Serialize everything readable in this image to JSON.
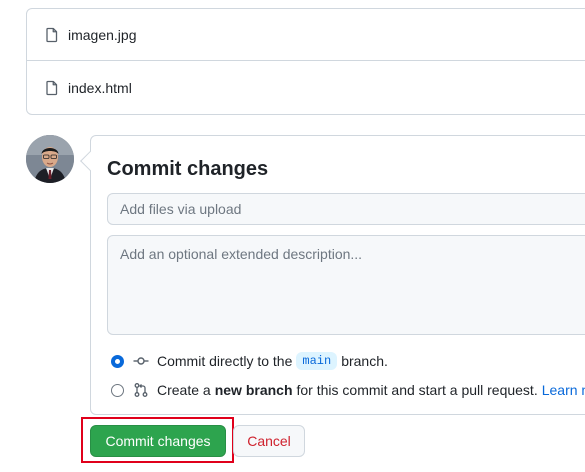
{
  "files": [
    {
      "name": "imagen.jpg",
      "icon": "file-icon"
    },
    {
      "name": "index.html",
      "icon": "file-icon"
    }
  ],
  "avatar": {
    "icon": "user-avatar"
  },
  "commit": {
    "title": "Commit changes",
    "summary_placeholder": "Add files via upload",
    "summary_value": "",
    "description_placeholder": "Add an optional extended description...",
    "description_value": "",
    "option_direct": {
      "text_before": "Commit directly to the",
      "branch": "main",
      "text_after": "branch.",
      "selected": true,
      "icon": "git-commit-icon"
    },
    "option_new_branch": {
      "text_before": "Create a",
      "bold": "new branch",
      "text_after": "for this commit and start a pull request.",
      "link": "Learn mo",
      "selected": false,
      "icon": "git-pull-request-icon"
    }
  },
  "buttons": {
    "commit_label": "Commit changes",
    "cancel_label": "Cancel"
  },
  "colors": {
    "primary_green": "#2da44e",
    "accent_blue": "#0969da",
    "danger_red": "#cf222e",
    "highlight_red": "#e0001b"
  }
}
